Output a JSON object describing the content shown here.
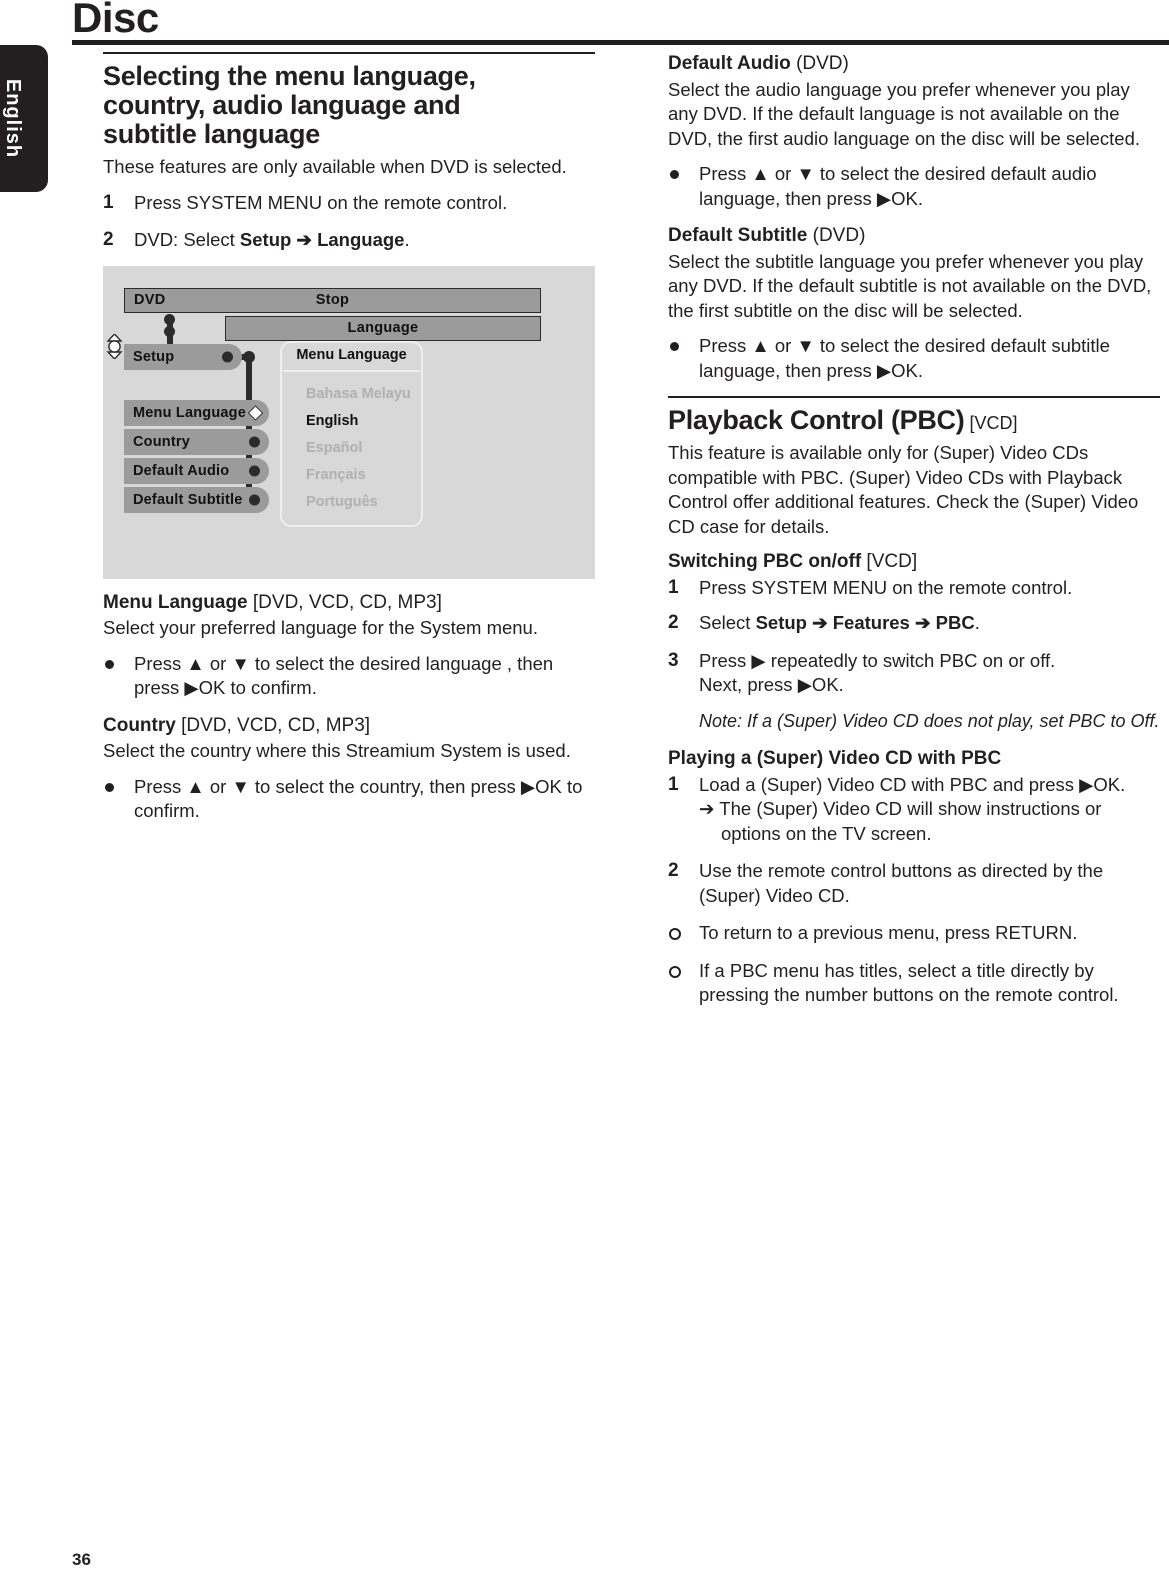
{
  "page": {
    "title": "Disc",
    "number": "36",
    "side_tab": "English"
  },
  "left_column": {
    "section_title_line1": "Selecting the menu language,",
    "section_title_line2": "country, audio language and",
    "section_title_line3": "subtitle language",
    "intro": "These features are only available when DVD is selected.",
    "steps": [
      {
        "num": "1",
        "text": "Press SYSTEM MENU on the remote control."
      },
      {
        "num": "2",
        "text_prefix": "DVD: Select ",
        "bold1": "Setup",
        "arrow": " ➔ ",
        "bold2": "Language",
        "text_suffix": "."
      }
    ],
    "diagram": {
      "status_bar": {
        "source": "DVD",
        "state": "Stop"
      },
      "submenu_bar": "Language",
      "menu_items": [
        {
          "label": "Setup",
          "marker": "dot"
        },
        {
          "label": "Menu Language",
          "marker": "diamond"
        },
        {
          "label": "Country",
          "marker": "dot"
        },
        {
          "label": "Default Audio",
          "marker": "dot"
        },
        {
          "label": "Default Subtitle",
          "marker": "dot"
        }
      ],
      "popup": {
        "title": "Menu Language",
        "options": [
          {
            "label": "Bahasa Melayu",
            "selected": false
          },
          {
            "label": "English",
            "selected": true
          },
          {
            "label": "Español",
            "selected": false
          },
          {
            "label": "Français",
            "selected": false
          },
          {
            "label": "Português",
            "selected": false
          }
        ]
      }
    },
    "menu_language": {
      "heading_bold": "Menu Language",
      "heading_light": " [DVD, VCD, CD, MP3]",
      "description": "Select your preferred language for the System menu.",
      "bullet": "Press ▲ or ▼ to select the desired language , then press ▶OK to confirm."
    },
    "country": {
      "heading_bold": "Country",
      "heading_light": " [DVD, VCD, CD, MP3]",
      "description": "Select the country where this Streamium System is used.",
      "bullet": "Press ▲ or ▼ to select the country, then press ▶OK to confirm."
    }
  },
  "right_column": {
    "default_audio": {
      "heading_bold": "Default Audio",
      "heading_light": " (DVD)",
      "description": "Select the audio language you prefer whenever you play any DVD. If the default language is not available on the DVD, the first audio language on the disc will be selected.",
      "bullet": "Press ▲ or ▼ to select the desired default audio language, then press ▶OK."
    },
    "default_subtitle": {
      "heading_bold": "Default Subtitle",
      "heading_light": " (DVD)",
      "description": "Select the subtitle language you prefer whenever you play any DVD. If the default subtitle is not available on the DVD, the first subtitle on the disc will be selected.",
      "bullet": "Press ▲ or ▼ to select the desired default subtitle language, then press ▶OK."
    },
    "pbc": {
      "title_bold": "Playback Control (PBC)",
      "title_light": " [VCD]",
      "description": "This feature is available only for (Super) Video CDs compatible with PBC. (Super) Video CDs with Playback Control offer additional features. Check the (Super) Video CD case for details.",
      "switching_heading_bold": "Switching PBC on/off",
      "switching_heading_light": " [VCD]",
      "switching_steps": [
        {
          "num": "1",
          "text": "Press SYSTEM MENU on the remote control."
        },
        {
          "num": "2",
          "text_prefix": "Select ",
          "bold1": "Setup",
          "arrow1": " ➔ ",
          "bold2": "Features",
          "arrow2": " ➔ ",
          "bold3": "PBC",
          "text_suffix": "."
        },
        {
          "num": "3",
          "line1": "Press ▶ repeatedly to switch PBC on or off.",
          "line2": "Next, press ▶OK."
        }
      ],
      "note": "Note: If a (Super) Video CD does not play, set PBC to Off.",
      "playing_heading": "Playing a (Super) Video CD with PBC",
      "playing_steps": [
        {
          "num": "1",
          "text": "Load a (Super) Video CD with PBC and press ▶OK.",
          "sub": "➔ The (Super) Video CD will show instructions or options on the TV screen."
        },
        {
          "num": "2",
          "text": "Use the remote control buttons as directed by the (Super) Video CD."
        }
      ],
      "bullets": [
        "To return to a previous menu, press RETURN.",
        "If a PBC menu has titles, select a title directly by pressing the number buttons on the remote control."
      ]
    }
  },
  "colors": {
    "ink": "#231f20",
    "osd_background": "#d8d8d8",
    "osd_bar": "#9b9b9b",
    "osd_outline": "#2b2b2b",
    "osd_dim_text": "#b0b0b0"
  }
}
